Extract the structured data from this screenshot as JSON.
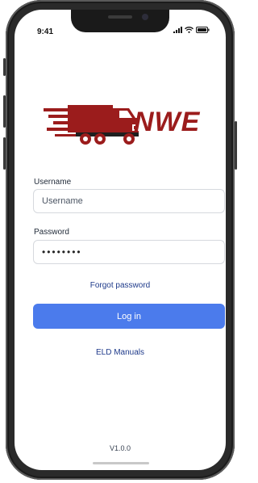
{
  "status_bar": {
    "time": "9:41"
  },
  "logo": {
    "text": "NWE",
    "brand_color": "#9b1c1c",
    "icon": "truck-icon"
  },
  "form": {
    "username_label": "Username",
    "username_placeholder": "Username",
    "password_label": "Password",
    "password_value": "••••••••"
  },
  "links": {
    "forgot_password": "Forgot password",
    "eld_manuals": "ELD Manuals"
  },
  "login_button": {
    "label": "Log in",
    "color": "#4b7bec"
  },
  "footer": {
    "version": "V1.0.0"
  }
}
